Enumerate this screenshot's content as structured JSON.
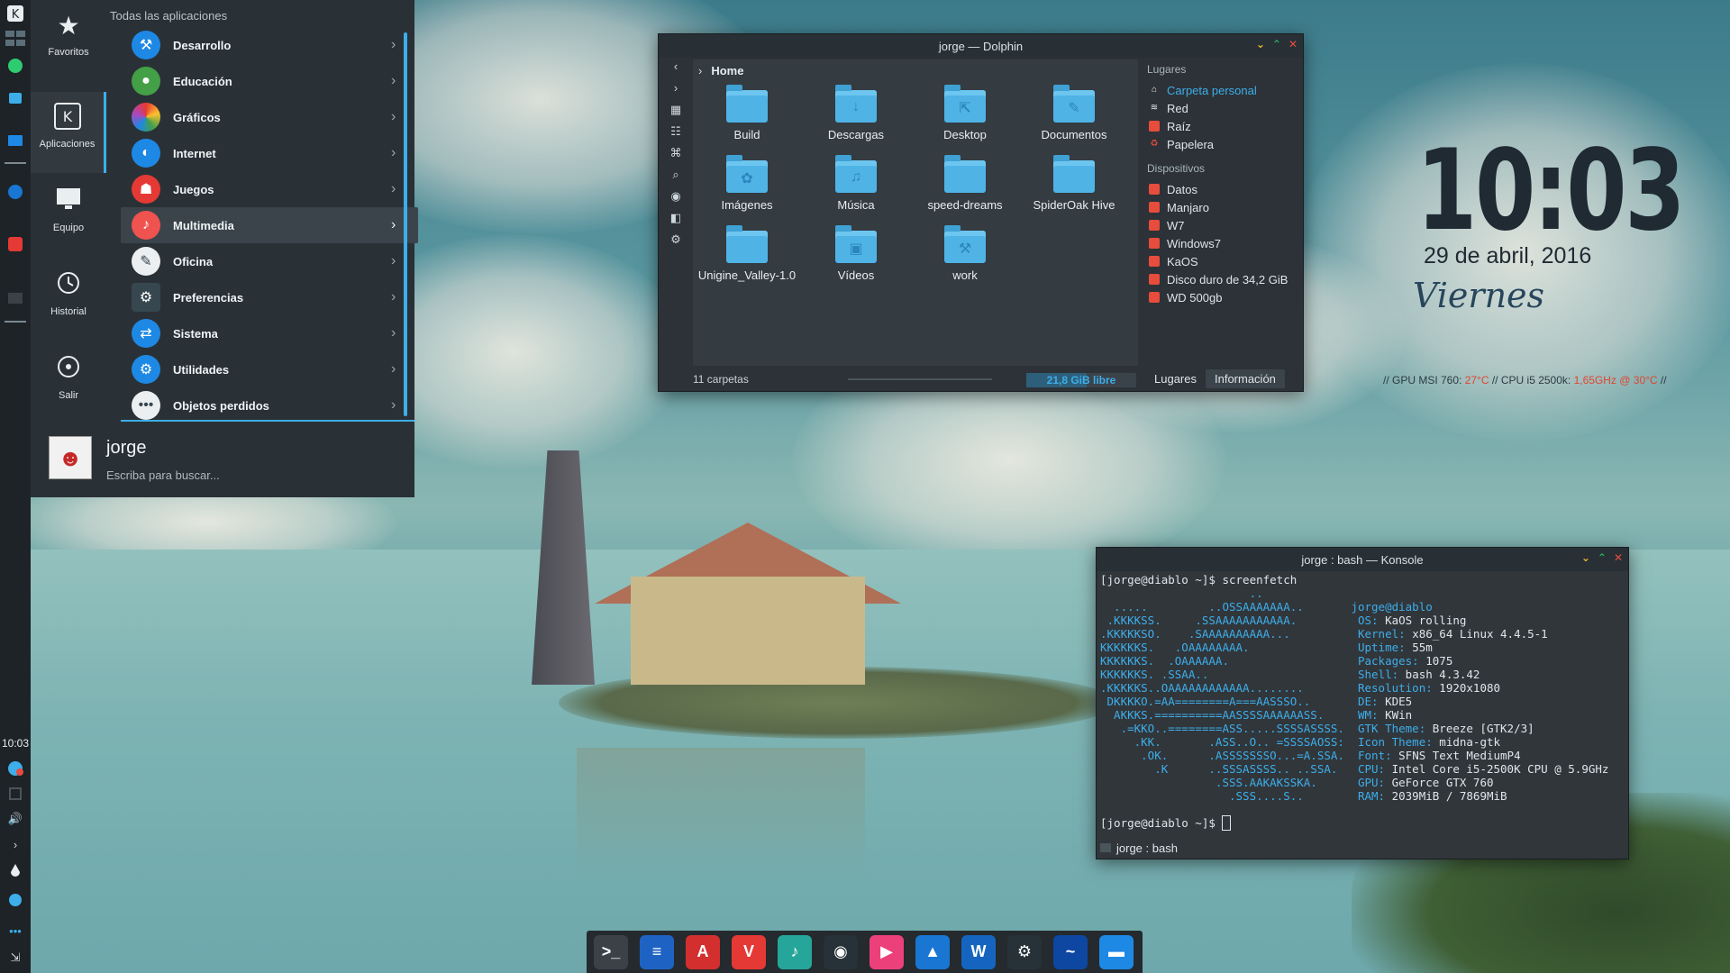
{
  "menu": {
    "apps_title": "Todas las aplicaciones",
    "categories": [
      {
        "label": "Favoritos",
        "icon": "star-icon"
      },
      {
        "label": "Aplicaciones",
        "icon": "kde-apps-icon"
      },
      {
        "label": "Equipo",
        "icon": "monitor-icon"
      },
      {
        "label": "Historial",
        "icon": "history-icon"
      },
      {
        "label": "Salir",
        "icon": "power-icon"
      }
    ],
    "apps": [
      {
        "label": "Desarrollo",
        "icon": "hammer-icon",
        "color": "#1e88e5"
      },
      {
        "label": "Educación",
        "icon": "apple-icon",
        "color": "#43a047"
      },
      {
        "label": "Gráficos",
        "icon": "palette-icon",
        "color": "#ab47bc"
      },
      {
        "label": "Internet",
        "icon": "globe-icon",
        "color": "#1e88e5"
      },
      {
        "label": "Juegos",
        "icon": "gamepad-icon",
        "color": "#e53935"
      },
      {
        "label": "Multimedia",
        "icon": "music-note-icon",
        "color": "#ef5350"
      },
      {
        "label": "Oficina",
        "icon": "paperclip-icon",
        "color": "#eceff1"
      },
      {
        "label": "Preferencias",
        "icon": "settings-icon",
        "color": "#37474f"
      },
      {
        "label": "Sistema",
        "icon": "system-icon",
        "color": "#1e88e5"
      },
      {
        "label": "Utilidades",
        "icon": "gear-icon",
        "color": "#1e88e5"
      },
      {
        "label": "Objetos perdidos",
        "icon": "more-icon",
        "color": "#eceff1"
      }
    ],
    "selected": "Multimedia",
    "user_name": "jorge",
    "search_hint": "Escriba para buscar..."
  },
  "panel": {
    "clock": "10:03"
  },
  "dolphin": {
    "title": "jorge — Dolphin",
    "breadcrumb": "Home",
    "folders": [
      {
        "name": "Build",
        "glyph": ""
      },
      {
        "name": "Descargas",
        "glyph": "↓"
      },
      {
        "name": "Desktop",
        "glyph": "⇱"
      },
      {
        "name": "Documentos",
        "glyph": "✎"
      },
      {
        "name": "Imágenes",
        "glyph": "✿"
      },
      {
        "name": "Música",
        "glyph": "♫"
      },
      {
        "name": "speed-dreams",
        "glyph": ""
      },
      {
        "name": "SpiderOak Hive",
        "glyph": ""
      },
      {
        "name": "Unigine_Valley-1.0",
        "glyph": ""
      },
      {
        "name": "Vídeos",
        "glyph": "▣"
      },
      {
        "name": "work",
        "glyph": "⚒"
      }
    ],
    "places_header": "Lugares",
    "places": [
      {
        "label": "Carpeta personal",
        "icon": "home-icon",
        "active": true
      },
      {
        "label": "Red",
        "icon": "network-icon"
      },
      {
        "label": "Raíz",
        "icon": "folder-red-icon"
      },
      {
        "label": "Papelera",
        "icon": "trash-icon"
      }
    ],
    "devices_header": "Dispositivos",
    "devices": [
      "Datos",
      "Manjaro",
      "W7",
      "Windows7",
      "KaOS",
      "Disco duro de 34,2 GiB",
      "WD 500gb"
    ],
    "status": "11 carpetas",
    "free_space": "21,8 GiB libre",
    "free_fraction": 0.55,
    "tabs": [
      "Lugares",
      "Información"
    ]
  },
  "konsole": {
    "title": "jorge : bash — Konsole",
    "tab_label": "jorge : bash",
    "prompt1": "[jorge@diablo ~]$ screenfetch",
    "prompt2": "[jorge@diablo ~]$ ",
    "user_host": "jorge@diablo",
    "logo": [
      "                      ..",
      "  .....         ..OSSAAAAAAA..",
      " .KKKKSS.     .SSAAAAAAAAAAA.",
      ".KKKKKSO.    .SAAAAAAAAAA...",
      "KKKKKKS.   .OAAAAAAAA.",
      "KKKKKKS.  .OAAAAAA.",
      "KKKKKKS. .SSAA..",
      ".KKKKKS..OAAAAAAAAAAAA........",
      " DKKKKO.=AA========A===AASSSO..",
      "  AKKKS.==========AASSSSAAAAAASS.",
      "   .=KKO..========ASS.....SSSSASSSS.",
      "     .KK.       .ASS..O.. =SSSSAOSS:",
      "      .OK.      .ASSSSSSSO...=A.SSA.",
      "        .K      ..SSSASSSS.. ..SSA.",
      "                 .SSS.AAKAKSSKA.",
      "                   .SSS....S.."
    ],
    "info": [
      {
        "key": "OS:",
        "value": "KaOS rolling"
      },
      {
        "key": "Kernel:",
        "value": "x86_64 Linux 4.4.5-1"
      },
      {
        "key": "Uptime:",
        "value": "55m"
      },
      {
        "key": "Packages:",
        "value": "1075"
      },
      {
        "key": "Shell:",
        "value": "bash 4.3.42"
      },
      {
        "key": "Resolution:",
        "value": "1920x1080"
      },
      {
        "key": "DE:",
        "value": "KDE5"
      },
      {
        "key": "WM:",
        "value": "KWin"
      },
      {
        "key": "GTK Theme:",
        "value": "Breeze [GTK2/3]"
      },
      {
        "key": "Icon Theme:",
        "value": "midna-gtk"
      },
      {
        "key": "Font:",
        "value": "SFNS Text MediumP4"
      },
      {
        "key": "CPU:",
        "value": "Intel Core i5-2500K CPU @ 5.9GHz"
      },
      {
        "key": "GPU:",
        "value": "GeForce GTX 760"
      },
      {
        "key": "RAM:",
        "value": "2039MiB / 7869MiB"
      }
    ]
  },
  "widget": {
    "time": "10:03",
    "date": "29 de abril, 2016",
    "day": "Viernes",
    "gpu_label": "// GPU MSI 760: ",
    "gpu_temp": "27°C",
    "cpu_label": "  // CPU i5 2500k: ",
    "cpu_value": "1,65GHz @ 30°C",
    "end": " //"
  },
  "dock": [
    {
      "name": "terminal",
      "icon": "terminal-icon",
      "color": "#3b4147",
      "glyph": ">_"
    },
    {
      "name": "notes",
      "icon": "notes-icon",
      "color": "#1e63c4",
      "glyph": "≡"
    },
    {
      "name": "pdf",
      "icon": "pdf-icon",
      "color": "#d32f2f",
      "glyph": "A"
    },
    {
      "name": "vivaldi",
      "icon": "vivaldi-icon",
      "color": "#e53935",
      "glyph": "V"
    },
    {
      "name": "music",
      "icon": "music-icon",
      "color": "#26a69a",
      "glyph": "♪"
    },
    {
      "name": "game",
      "icon": "panda-icon",
      "color": "#263238",
      "glyph": "◉"
    },
    {
      "name": "media",
      "icon": "play-icon",
      "color": "#ec407a",
      "glyph": "▶"
    },
    {
      "name": "vpn",
      "icon": "arrow-up-icon",
      "color": "#1976d2",
      "glyph": "▲"
    },
    {
      "name": "wordpress",
      "icon": "wordpress-icon",
      "color": "#1565c0",
      "glyph": "W"
    },
    {
      "name": "settings",
      "icon": "gear-icon",
      "color": "#263238",
      "glyph": "⚙"
    },
    {
      "name": "browser",
      "icon": "wave-icon",
      "color": "#0d47a1",
      "glyph": "~"
    },
    {
      "name": "files",
      "icon": "folder-icon",
      "color": "#1e88e5",
      "glyph": "▬"
    }
  ]
}
